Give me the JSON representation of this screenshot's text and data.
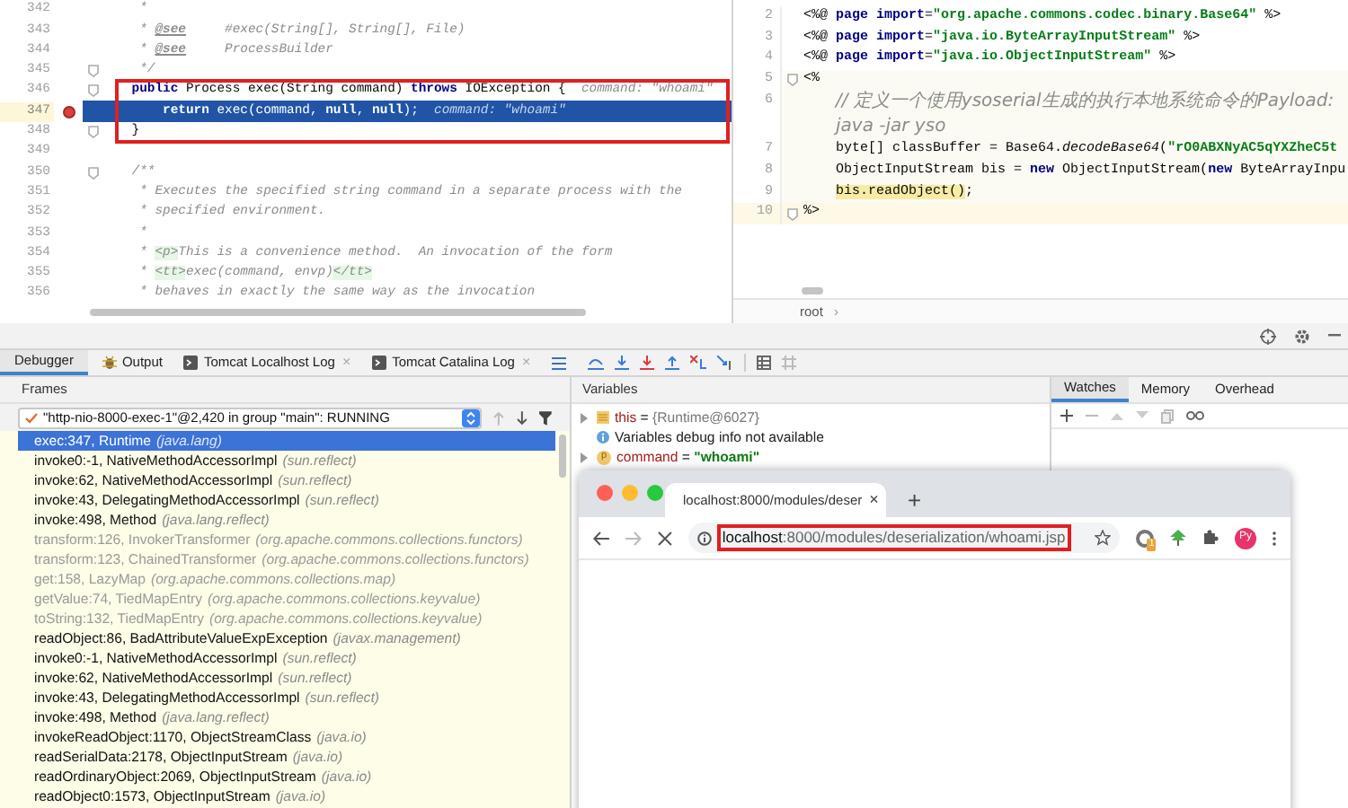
{
  "left_editor": {
    "lines": [
      {
        "number": "342",
        "fold": false,
        "breakpoint": false,
        "current": false,
        "boxed": false,
        "segments": [
          {
            "kind": "comment",
            "text": "     *"
          }
        ]
      },
      {
        "number": "343",
        "fold": false,
        "breakpoint": false,
        "current": false,
        "boxed": false,
        "segments": [
          {
            "kind": "comment",
            "text": "     * "
          },
          {
            "kind": "doctag",
            "text": "@see"
          },
          {
            "kind": "comment",
            "text": "     #exec(String[], String[], File)"
          }
        ]
      },
      {
        "number": "344",
        "fold": false,
        "breakpoint": false,
        "current": false,
        "boxed": false,
        "segments": [
          {
            "kind": "comment",
            "text": "     * "
          },
          {
            "kind": "doctag",
            "text": "@see"
          },
          {
            "kind": "comment",
            "text": "     ProcessBuilder"
          }
        ]
      },
      {
        "number": "345",
        "fold": true,
        "breakpoint": false,
        "current": false,
        "boxed": false,
        "segments": [
          {
            "kind": "comment",
            "text": "     */"
          }
        ]
      },
      {
        "number": "346",
        "fold": true,
        "breakpoint": false,
        "current": false,
        "boxed": true,
        "segments": [
          {
            "kind": "keyword",
            "text": "    public"
          },
          {
            "kind": "plain",
            "text": " Process exec(String command) "
          },
          {
            "kind": "keyword",
            "text": "throws"
          },
          {
            "kind": "plain",
            "text": " IOException {"
          },
          {
            "kind": "hint",
            "text": "  command: \"whoami\""
          }
        ]
      },
      {
        "number": "347",
        "fold": false,
        "breakpoint": true,
        "current": true,
        "boxed": true,
        "segments": [
          {
            "kind": "keyword",
            "text": "        return"
          },
          {
            "kind": "plain",
            "text": " exec(command, "
          },
          {
            "kind": "keyword",
            "text": "null"
          },
          {
            "kind": "plain",
            "text": ", "
          },
          {
            "kind": "keyword",
            "text": "null"
          },
          {
            "kind": "plain",
            "text": ");"
          },
          {
            "kind": "hint",
            "text": "  command: \"whoami\""
          }
        ]
      },
      {
        "number": "348",
        "fold": true,
        "breakpoint": false,
        "current": false,
        "boxed": true,
        "segments": [
          {
            "kind": "plain",
            "text": "    }"
          }
        ]
      },
      {
        "number": "349",
        "fold": false,
        "breakpoint": false,
        "current": false,
        "boxed": false
      },
      {
        "number": "350",
        "fold": true,
        "breakpoint": false,
        "current": false,
        "boxed": false,
        "segments": [
          {
            "kind": "comment",
            "text": "    /**"
          }
        ]
      },
      {
        "number": "351",
        "fold": false,
        "breakpoint": false,
        "current": false,
        "boxed": false,
        "segments": [
          {
            "kind": "comment",
            "text": "     * Executes the specified string command in a separate process with the"
          }
        ]
      },
      {
        "number": "352",
        "fold": false,
        "breakpoint": false,
        "current": false,
        "boxed": false,
        "segments": [
          {
            "kind": "comment",
            "text": "     * specified environment."
          }
        ]
      },
      {
        "number": "353",
        "fold": false,
        "breakpoint": false,
        "current": false,
        "boxed": false,
        "segments": [
          {
            "kind": "comment",
            "text": "     *"
          }
        ]
      },
      {
        "number": "354",
        "fold": false,
        "breakpoint": false,
        "current": false,
        "boxed": false,
        "segments": [
          {
            "kind": "comment",
            "text": "     * "
          },
          {
            "kind": "tag",
            "text": "<p>"
          },
          {
            "kind": "comment",
            "text": "This is a convenience method.  An invocation of the form"
          }
        ]
      },
      {
        "number": "355",
        "fold": false,
        "breakpoint": false,
        "current": false,
        "boxed": false,
        "segments": [
          {
            "kind": "comment",
            "text": "     * "
          },
          {
            "kind": "tag",
            "text": "<tt>"
          },
          {
            "kind": "comment",
            "text": "exec(command, envp)"
          },
          {
            "kind": "tag",
            "text": "</tt>"
          }
        ]
      },
      {
        "number": "356",
        "fold": false,
        "breakpoint": false,
        "current": false,
        "boxed": false,
        "segments": [
          {
            "kind": "comment",
            "text": "     * behaves in exactly the same way as the invocation"
          }
        ]
      }
    ]
  },
  "right_editor": {
    "lines": [
      {
        "number": "2",
        "kind": "directive",
        "fold": false,
        "scriptlet": false,
        "current": false,
        "segments": [
          {
            "kind": "plain",
            "text": "<%@ "
          },
          {
            "kind": "keyword",
            "text": "page import"
          },
          {
            "kind": "plain",
            "text": "="
          },
          {
            "kind": "string",
            "text": "\"org.apache.commons.codec.binary.Base64\""
          },
          {
            "kind": "plain",
            "text": " %>"
          }
        ]
      },
      {
        "number": "3",
        "kind": "directive",
        "fold": false,
        "scriptlet": false,
        "current": false,
        "segments": [
          {
            "kind": "plain",
            "text": "<%@ "
          },
          {
            "kind": "keyword",
            "text": "page import"
          },
          {
            "kind": "plain",
            "text": "="
          },
          {
            "kind": "string",
            "text": "\"java.io.ByteArrayInputStream\""
          },
          {
            "kind": "plain",
            "text": " %>"
          }
        ]
      },
      {
        "number": "4",
        "kind": "directive",
        "fold": false,
        "scriptlet": false,
        "current": false,
        "segments": [
          {
            "kind": "plain",
            "text": "<%@ "
          },
          {
            "kind": "keyword",
            "text": "page import"
          },
          {
            "kind": "plain",
            "text": "="
          },
          {
            "kind": "string",
            "text": "\"java.io.ObjectInputStream\""
          },
          {
            "kind": "plain",
            "text": " %>"
          }
        ]
      },
      {
        "number": "5",
        "kind": "delimiter",
        "fold": true,
        "scriptlet": true,
        "current": false,
        "segments": [
          {
            "kind": "plain",
            "text": "<%"
          }
        ]
      },
      {
        "number": "6",
        "kind": "statement",
        "fold": false,
        "scriptlet": true,
        "current": false,
        "segments": [
          {
            "kind": "note",
            "text": "// 定义一个使用ysoserial生成的执行本地系统命令的Payload: java -jar yso"
          }
        ]
      },
      {
        "number": "7",
        "kind": "statement",
        "fold": false,
        "scriptlet": true,
        "current": false,
        "segments": [
          {
            "kind": "plain",
            "text": "byte[] classBuffer = Base64."
          },
          {
            "kind": "static",
            "text": "decodeBase64"
          },
          {
            "kind": "plain",
            "text": "("
          },
          {
            "kind": "string",
            "text": "\"rO0ABXNyAC5qYXZheC5t"
          }
        ]
      },
      {
        "number": "8",
        "kind": "statement",
        "fold": false,
        "scriptlet": true,
        "current": false,
        "segments": [
          {
            "kind": "plain",
            "text": "ObjectInputStream bis = "
          },
          {
            "kind": "keyword",
            "text": "new"
          },
          {
            "kind": "plain",
            "text": " ObjectInputStream("
          },
          {
            "kind": "keyword",
            "text": "new"
          },
          {
            "kind": "plain",
            "text": " ByteArrayInpu"
          }
        ]
      },
      {
        "number": "9",
        "kind": "statement",
        "fold": false,
        "scriptlet": true,
        "current": false,
        "segments": [
          {
            "kind": "marked",
            "text": "bis.readObject()"
          },
          {
            "kind": "plain",
            "text": ";"
          }
        ]
      },
      {
        "number": "10",
        "kind": "delimiter",
        "fold": true,
        "scriptlet": false,
        "current": true,
        "segments": [
          {
            "kind": "plain",
            "text": "%>"
          }
        ]
      }
    ],
    "breadcrumb": "root",
    "breadcrumb_sep": "›"
  },
  "tool_tabs": [
    {
      "label": "Debugger",
      "kind": "debugger",
      "closable": false,
      "selected": true
    },
    {
      "label": "Output",
      "kind": "output",
      "closable": false,
      "selected": false
    },
    {
      "label": "Tomcat Localhost Log",
      "kind": "log",
      "closable": true,
      "selected": false
    },
    {
      "label": "Tomcat Catalina Log",
      "kind": "log",
      "closable": true,
      "selected": false
    }
  ],
  "close_glyph": "×",
  "frames": {
    "title": "Frames",
    "thread": "\"http-nio-8000-exec-1\"@2,420 in group \"main\": RUNNING",
    "items": [
      {
        "method": "exec:347, Runtime",
        "package": "(java.lang)",
        "dimmed": false,
        "selected": true
      },
      {
        "method": "invoke0:-1, NativeMethodAccessorImpl",
        "package": "(sun.reflect)",
        "dimmed": false,
        "selected": false
      },
      {
        "method": "invoke:62, NativeMethodAccessorImpl",
        "package": "(sun.reflect)",
        "dimmed": false,
        "selected": false
      },
      {
        "method": "invoke:43, DelegatingMethodAccessorImpl",
        "package": "(sun.reflect)",
        "dimmed": false,
        "selected": false
      },
      {
        "method": "invoke:498, Method",
        "package": "(java.lang.reflect)",
        "dimmed": false,
        "selected": false
      },
      {
        "method": "transform:126, InvokerTransformer",
        "package": "(org.apache.commons.collections.functors)",
        "dimmed": true,
        "selected": false
      },
      {
        "method": "transform:123, ChainedTransformer",
        "package": "(org.apache.commons.collections.functors)",
        "dimmed": true,
        "selected": false
      },
      {
        "method": "get:158, LazyMap",
        "package": "(org.apache.commons.collections.map)",
        "dimmed": true,
        "selected": false
      },
      {
        "method": "getValue:74, TiedMapEntry",
        "package": "(org.apache.commons.collections.keyvalue)",
        "dimmed": true,
        "selected": false
      },
      {
        "method": "toString:132, TiedMapEntry",
        "package": "(org.apache.commons.collections.keyvalue)",
        "dimmed": true,
        "selected": false
      },
      {
        "method": "readObject:86, BadAttributeValueExpException",
        "package": "(javax.management)",
        "dimmed": false,
        "selected": false
      },
      {
        "method": "invoke0:-1, NativeMethodAccessorImpl",
        "package": "(sun.reflect)",
        "dimmed": false,
        "selected": false
      },
      {
        "method": "invoke:62, NativeMethodAccessorImpl",
        "package": "(sun.reflect)",
        "dimmed": false,
        "selected": false
      },
      {
        "method": "invoke:43, DelegatingMethodAccessorImpl",
        "package": "(sun.reflect)",
        "dimmed": false,
        "selected": false
      },
      {
        "method": "invoke:498, Method",
        "package": "(java.lang.reflect)",
        "dimmed": false,
        "selected": false
      },
      {
        "method": "invokeReadObject:1170, ObjectStreamClass",
        "package": "(java.io)",
        "dimmed": false,
        "selected": false
      },
      {
        "method": "readSerialData:2178, ObjectInputStream",
        "package": "(java.io)",
        "dimmed": false,
        "selected": false
      },
      {
        "method": "readOrdinaryObject:2069, ObjectInputStream",
        "package": "(java.io)",
        "dimmed": false,
        "selected": false
      },
      {
        "method": "readObject0:1573, ObjectInputStream",
        "package": "(java.io)",
        "dimmed": false,
        "selected": false
      }
    ]
  },
  "variables": {
    "title": "Variables",
    "items": [
      {
        "kind": "field",
        "expandable": true,
        "name": "this",
        "eq": " = ",
        "value": "{Runtime@6027}"
      },
      {
        "kind": "info",
        "expandable": false,
        "text": "Variables debug info not available"
      },
      {
        "kind": "param",
        "expandable": true,
        "name": "command",
        "eq": " = ",
        "value": "\"whoami\"",
        "icon_letter": "p"
      }
    ]
  },
  "watches_tabs": [
    {
      "label": "Watches",
      "selected": true
    },
    {
      "label": "Memory",
      "selected": false
    },
    {
      "label": "Overhead",
      "selected": false
    }
  ],
  "browser": {
    "tab_title": "localhost:8000/modules/deser",
    "tab_close": "×",
    "new_tab": "+",
    "url_host": "localhost",
    "url_rest": ":8000/modules/deserialization/whoami.jsp",
    "url_highlighted": true,
    "extension_badge": "1",
    "avatar": "Py"
  }
}
